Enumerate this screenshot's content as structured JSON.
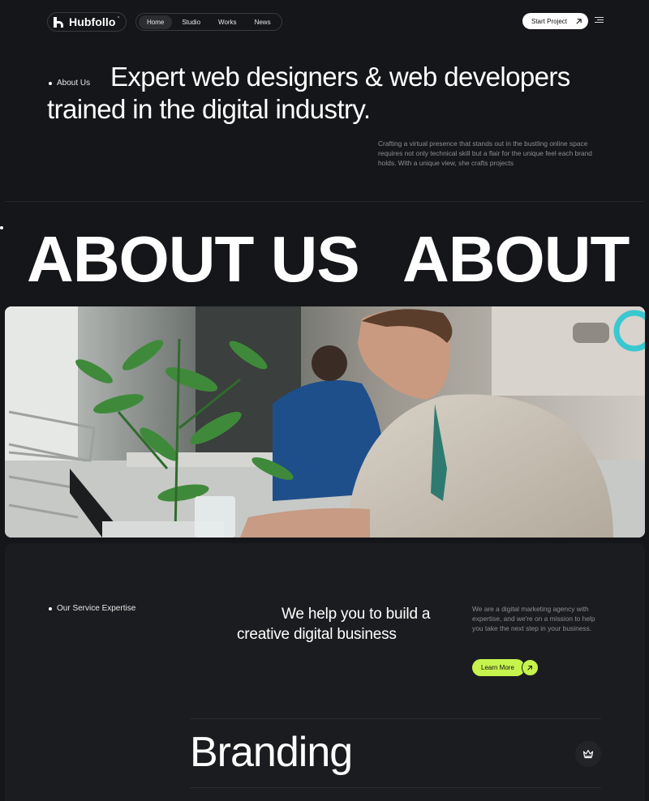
{
  "header": {
    "logo_text": "Hubfollo",
    "logo_mark": "°",
    "nav": [
      {
        "label": "Home",
        "active": true
      },
      {
        "label": "Studio",
        "active": false
      },
      {
        "label": "Works",
        "active": false
      },
      {
        "label": "News",
        "active": false
      }
    ],
    "cta_label": "Start Project",
    "cta_icon": "arrow-up-right-icon",
    "menu_icon": "hamburger-menu-icon"
  },
  "hero": {
    "label": "About Us",
    "title_line1": "Expert web designers & web developers",
    "title_line2": "trained in the digital industry.",
    "description": "Crafting a virtual presence that stands out in the bustling online space requires not only technical skill but a flair for the unique feel each brand holds. With a unique view, she crafts projects"
  },
  "marquee": {
    "text_1": "ABOUT US",
    "text_2": "ABOUT US"
  },
  "photo": {
    "subject": "man working on laptop in office with plant"
  },
  "services": {
    "label": "Our Service Expertise",
    "heading_line1": "We help you to build a",
    "heading_line2": "creative digital business",
    "description": "We are a digital marketing agency with expertise, and we're on a mission to help you take the next step in your business.",
    "button_label": "Learn More",
    "button_icon": "arrow-up-right-icon",
    "first_service": "Branding",
    "first_service_icon": "crown-icon"
  },
  "colors": {
    "background": "#151619",
    "panel": "#1b1c1f",
    "accent": "#c6f44d",
    "muted_text": "#8d8e92"
  }
}
